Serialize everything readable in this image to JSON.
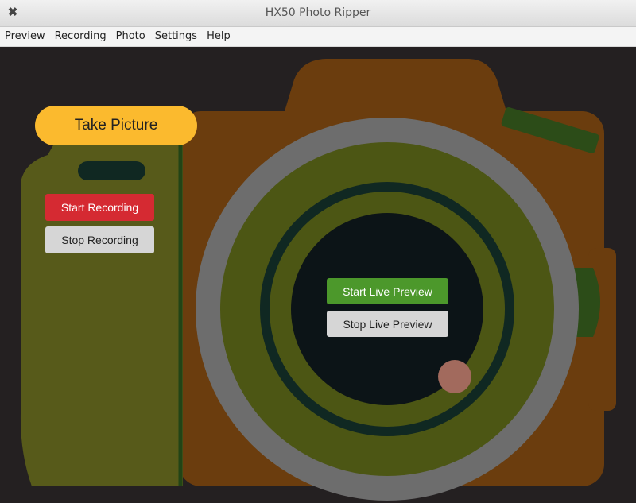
{
  "window": {
    "title": "HX50 Photo Ripper",
    "close_icon": "close-icon"
  },
  "menu": [
    "Preview",
    "Recording",
    "Photo",
    "Settings",
    "Help"
  ],
  "buttons": {
    "take_picture": "Take Picture",
    "start_recording": "Start Recording",
    "stop_recording": "Stop Recording",
    "start_live_preview": "Start Live Preview",
    "stop_live_preview": "Stop Live Preview"
  },
  "colors": {
    "background": "#242021",
    "camera_body": "#6b3d0e",
    "grip": "#575a1a",
    "lens_outer": "#6d6d6d",
    "lens_olive": "#4c5614",
    "lens_dark_ring": "#102822",
    "lens_glass": "#0c1417",
    "accent_dot": "#a26a5d",
    "take_picture": "#fbba2e",
    "start_recording": "#d52a32",
    "start_live_preview": "#4c982b",
    "stop_buttons": "#d6d6d6"
  }
}
